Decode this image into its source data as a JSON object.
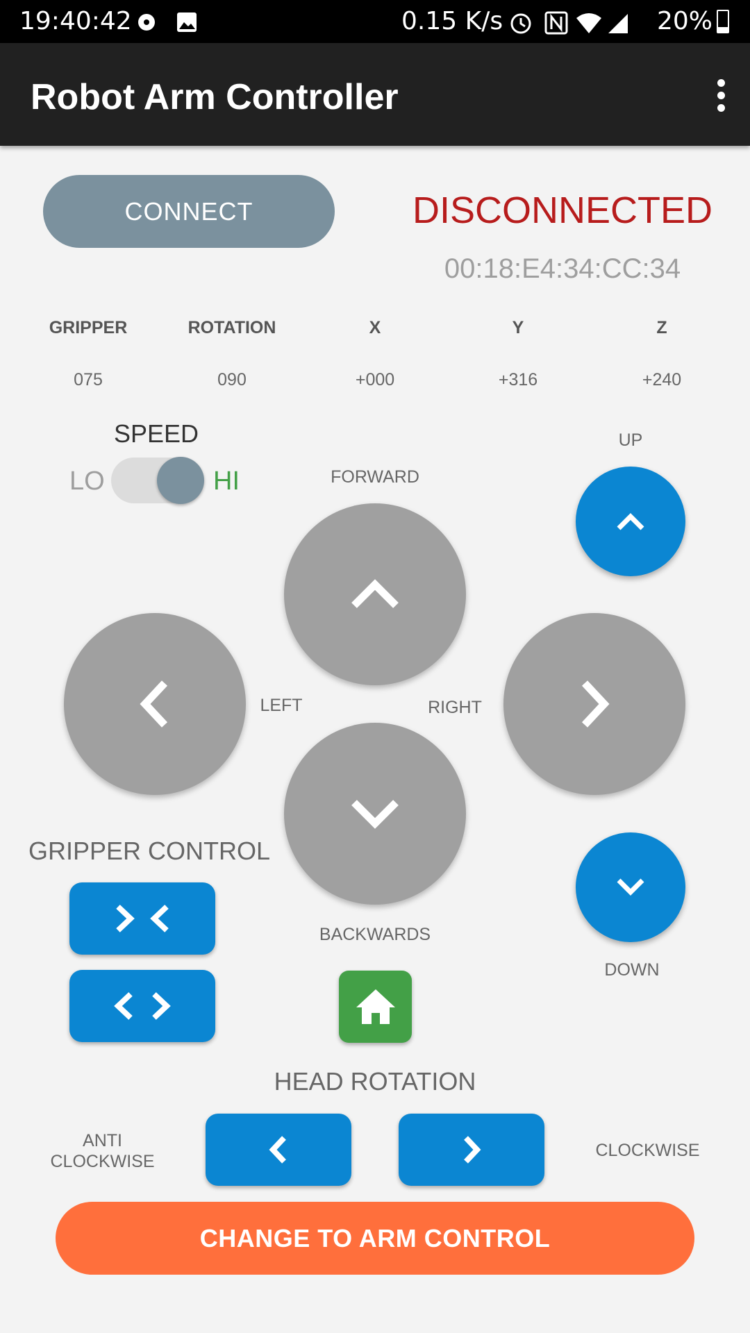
{
  "status_bar": {
    "time": "19:40:42",
    "net_speed": "0.15 K/s",
    "battery": "20%"
  },
  "app_bar": {
    "title": "Robot Arm Controller"
  },
  "connection": {
    "button_label": "CONNECT",
    "status": "DISCONNECTED",
    "address": "00:18:E4:34:CC:34"
  },
  "readouts": [
    {
      "label": "GRIPPER",
      "value": "075"
    },
    {
      "label": "ROTATION",
      "value": "090"
    },
    {
      "label": "X",
      "value": "+000"
    },
    {
      "label": "Y",
      "value": "+316"
    },
    {
      "label": "Z",
      "value": "+240"
    }
  ],
  "speed": {
    "label": "SPEED",
    "lo": "LO",
    "hi": "HI",
    "selected": "HI"
  },
  "movement": {
    "forward": "FORWARD",
    "backwards": "BACKWARDS",
    "left": "LEFT",
    "right": "RIGHT",
    "up": "UP",
    "down": "DOWN"
  },
  "gripper": {
    "title": "GRIPPER CONTROL"
  },
  "head_rotation": {
    "title": "HEAD ROTATION",
    "anti_line1": "ANTI",
    "anti_line2": "CLOCKWISE",
    "clockwise": "CLOCKWISE"
  },
  "arm_button": {
    "label": "CHANGE TO ARM CONTROL"
  },
  "colors": {
    "accent_blue": "#0b86d2",
    "grey_button": "#a0a0a0",
    "connect_button": "#7b919e",
    "disconnected_red": "#b71c1c",
    "hi_green": "#43a047",
    "arm_button_orange": "#ff6f3c"
  },
  "icons": [
    "chevron-up-icon",
    "chevron-down-icon",
    "chevron-left-icon",
    "chevron-right-icon",
    "home-icon",
    "more-vert-icon",
    "alarm-icon",
    "nfc-icon",
    "wifi-icon",
    "signal-icon",
    "battery-icon",
    "image-icon"
  ]
}
